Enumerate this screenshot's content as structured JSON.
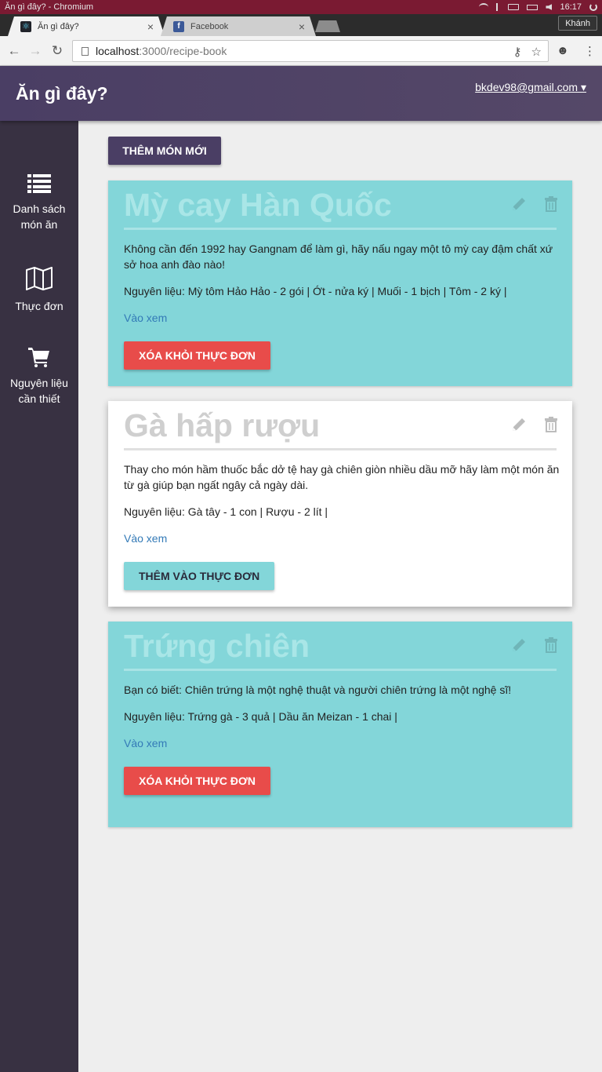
{
  "os": {
    "window_title": "Ăn gì đây? - Chromium",
    "time": "16:17"
  },
  "browser": {
    "tabs": [
      {
        "label": "Ăn gì đây?",
        "active": true
      },
      {
        "label": "Facebook",
        "active": false
      }
    ],
    "profile": "Khánh",
    "url_host": "localhost",
    "url_path": ":3000/recipe-book"
  },
  "app": {
    "title": "Ăn gì đây?",
    "user_menu": "bkdev98@gmail.com ▾"
  },
  "sidebar": {
    "items": [
      {
        "label_line1": "Danh sách",
        "label_line2": "món ăn",
        "icon": "list-icon"
      },
      {
        "label_line1": "Thực đơn",
        "label_line2": "",
        "icon": "map-icon"
      },
      {
        "label_line1": "Nguyên liệu",
        "label_line2": "cần thiết",
        "icon": "cart-icon"
      }
    ]
  },
  "main": {
    "add_button": "THÊM MÓN MỚI",
    "recipes": [
      {
        "title": "Mỳ cay Hàn Quốc",
        "description": "Không cần đến 1992 hay Gangnam để làm gì, hãy nấu ngay một tô mỳ cay đậm chất xứ sở hoa anh đào nào!",
        "ingredients": "Nguyên liệu: Mỳ tôm Hảo Hảo - 2 gói | Ớt - nửa ký | Muối - 1 bịch | Tôm - 2 ký |",
        "link": "Vào xem",
        "button": "XÓA KHỎI THỰC ĐƠN",
        "in_menu": true
      },
      {
        "title": "Gà hấp rượu",
        "description": "Thay cho món hầm thuốc bắc dở tệ hay gà chiên giòn nhiều dầu mỡ hãy làm một món ăn từ gà giúp bạn ngất ngây cả ngày dài.",
        "ingredients": "Nguyên liệu: Gà tây - 1 con | Rượu - 2 lít |",
        "link": "Vào xem",
        "button": "THÊM VÀO THỰC ĐƠN",
        "in_menu": false
      },
      {
        "title": "Trứng chiên",
        "description": "Bạn có biết: Chiên trứng là một nghệ thuật và người chiên trứng là một nghệ sĩ!",
        "ingredients": "Nguyên liệu: Trứng gà - 3 quả | Dầu ăn Meizan - 1 chai |",
        "link": "Vào xem",
        "button": "XÓA KHỎI THỰC ĐƠN",
        "in_menu": true
      }
    ]
  },
  "colors": {
    "header": "#4a3e64",
    "sidebar": "#383142",
    "card_in_menu": "#83d6d9",
    "remove_button": "#e84c4a",
    "link": "#337ab7"
  }
}
